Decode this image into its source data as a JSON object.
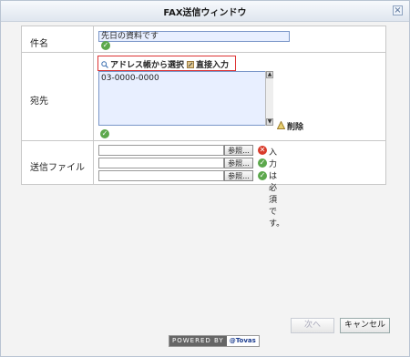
{
  "window": {
    "title": "FAX送信ウィンドウ",
    "close_label": "×"
  },
  "form": {
    "subject": {
      "label": "件名",
      "value": "先日の資料です"
    },
    "destination": {
      "label": "宛先",
      "address_book_label": "アドレス帳から選択",
      "direct_input_label": "直接入力",
      "value": "03-0000-0000",
      "delete_label": "削除"
    },
    "attachments": {
      "label": "送信ファイル",
      "browse_label": "参照...",
      "required_message": "入力は必須です。"
    }
  },
  "footer": {
    "next_label": "次へ",
    "cancel_label": "キャンセル",
    "powered_by_label": "POWERED BY",
    "brand_label": "@Tovas"
  },
  "colors": {
    "accent_border": "#dd3333",
    "ok_green": "#5ca84c",
    "error_red": "#d93b2b"
  }
}
